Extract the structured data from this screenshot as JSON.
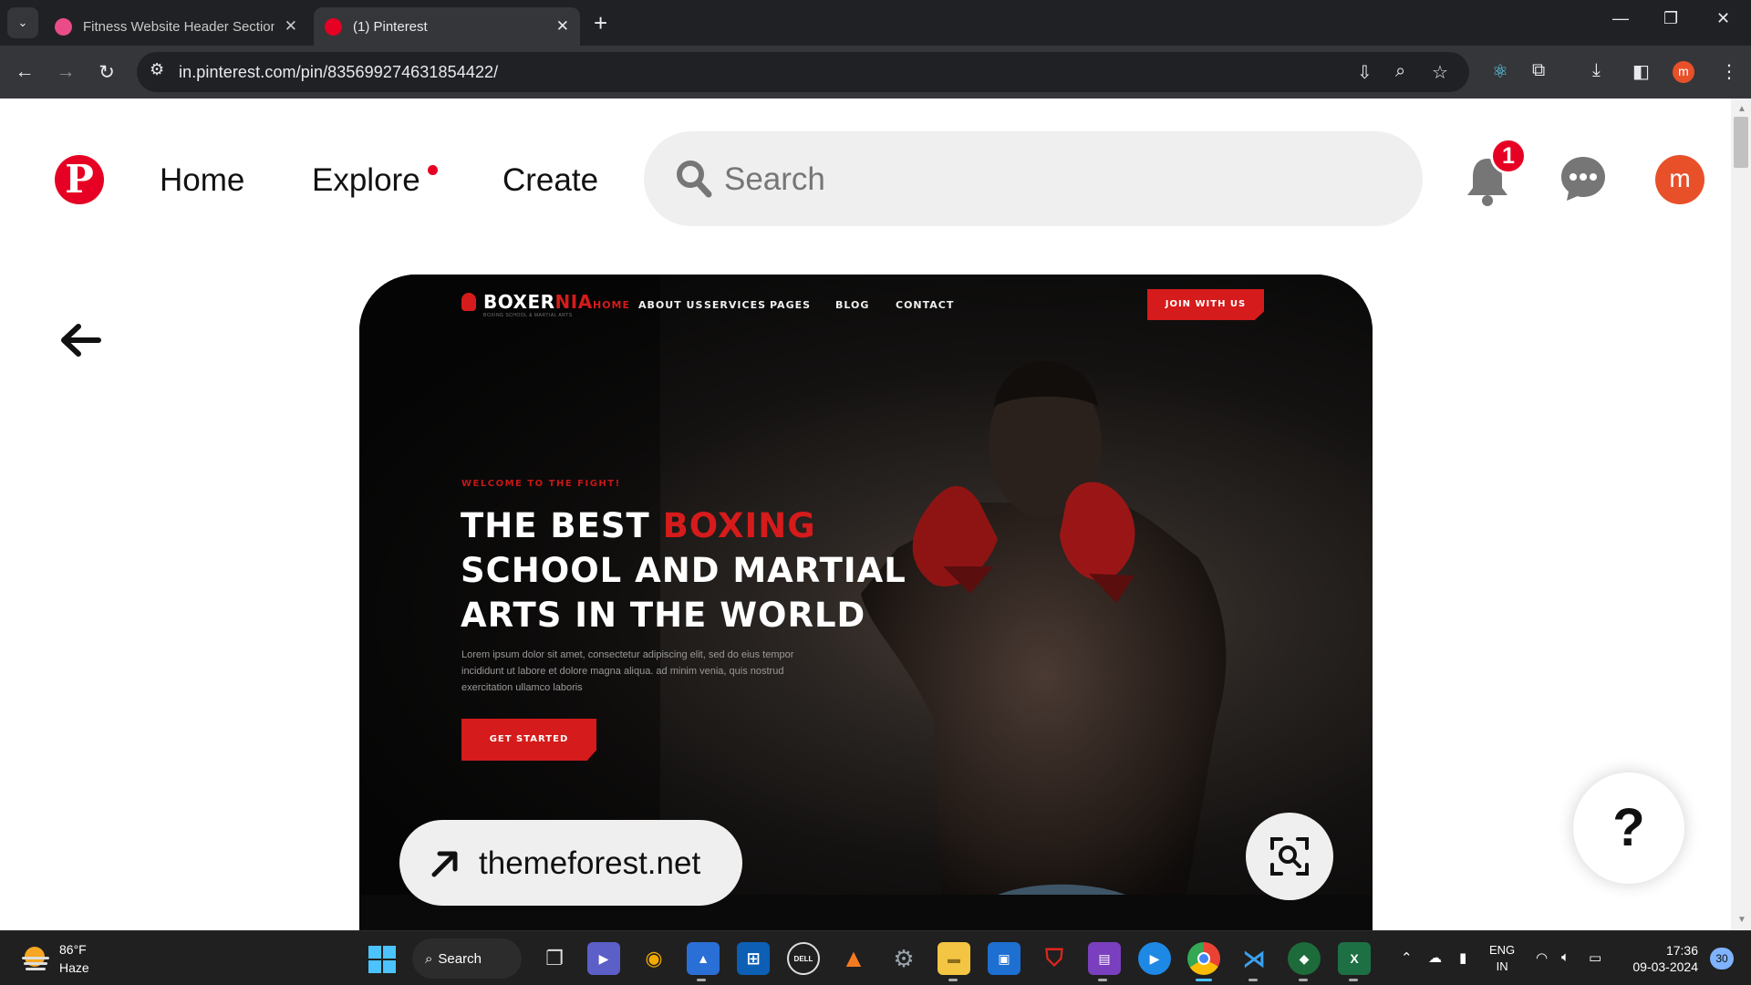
{
  "browser": {
    "tabs": [
      {
        "title": "Fitness Website Header Section",
        "active": false
      },
      {
        "title": "(1) Pinterest",
        "active": true
      }
    ],
    "url": "in.pinterest.com/pin/835699274631854422/",
    "profile_initial": "m"
  },
  "pinterest": {
    "nav": {
      "home": "Home",
      "explore": "Explore",
      "create": "Create"
    },
    "search_placeholder": "Search",
    "notification_count": "1",
    "avatar_initial": "m",
    "source_label": "themeforest.net",
    "help_label": "?"
  },
  "pin_image": {
    "brand_white": "BOXER",
    "brand_red": "NIA",
    "brand_sub": "BOXING SCHOOL & MARTIAL ARTS",
    "nav": [
      "HOME",
      "ABOUT US",
      "SERVICES",
      "PAGES",
      "BLOG",
      "CONTACT"
    ],
    "join_button": "JOIN WITH US",
    "welcome": "WELCOME TO THE FIGHT!",
    "headline_1_white": "THE BEST ",
    "headline_1_red": "BOXING",
    "headline_2": "SCHOOL AND MARTIAL",
    "headline_3": "ARTS IN THE WORLD",
    "body": "Lorem ipsum dolor sit amet, consectetur adipiscing elit, sed do eius tempor incididunt ut labore et dolore magna aliqua. ad minim venia, quis nostrud exercitation ullamco laboris",
    "cta": "GET STARTED"
  },
  "taskbar": {
    "weather_temp": "86°F",
    "weather_desc": "Haze",
    "search_label": "Search",
    "lang_top": "ENG",
    "lang_bottom": "IN",
    "time": "17:36",
    "date": "09-03-2024",
    "notification_count": "30"
  },
  "colors": {
    "pinterest_red": "#e60023",
    "boxing_red": "#d51b1b",
    "chrome_dark": "#202124",
    "chrome_toolbar": "#35363a"
  }
}
